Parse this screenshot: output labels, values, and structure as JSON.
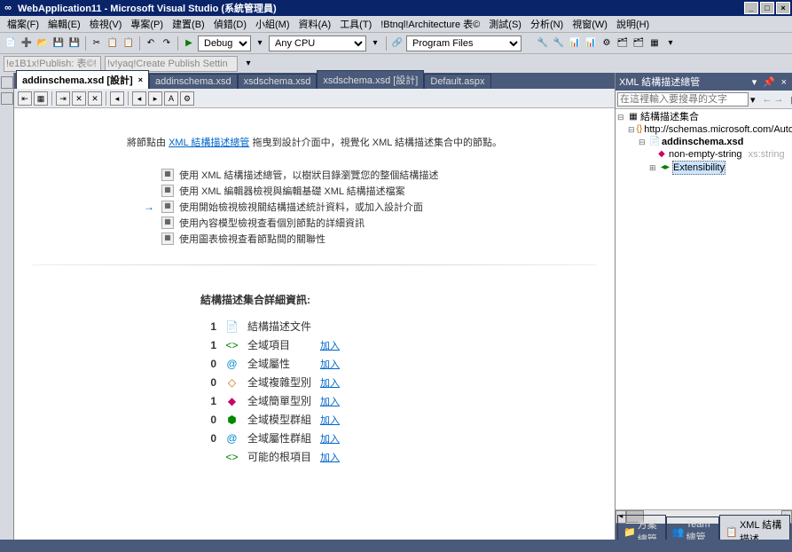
{
  "title": "WebApplication11 - Microsoft Visual Studio (系統管理員)",
  "menu": [
    "檔案(F)",
    "編輯(E)",
    "檢視(V)",
    "專案(P)",
    "建置(B)",
    "偵錯(D)",
    "小組(M)",
    "資料(A)",
    "工具(T)",
    "!Btnql!Architecture 表©",
    "測試(S)",
    "分析(N)",
    "視窗(W)",
    "說明(H)"
  ],
  "toolbar_combo_config": "Debug",
  "toolbar_combo_platform": "Any CPU",
  "toolbar_combo_find": "Program Files",
  "publish_text1": "!e1B1x!Publish: 表©!",
  "publish_text2": "!v!yaq!Create Publish Settin",
  "tabs": [
    {
      "label": "addinschema.xsd [設計]",
      "active": true,
      "close": true
    },
    {
      "label": "addinschema.xsd",
      "active": false,
      "close": false
    },
    {
      "label": "xsdschema.xsd",
      "active": false,
      "close": false
    },
    {
      "label": "xsdschema.xsd [設計]",
      "active": false,
      "close": false
    },
    {
      "label": "Default.aspx",
      "active": false,
      "close": false
    }
  ],
  "help_prefix": "將節點由 ",
  "help_link": "XML 結構描述總管",
  "help_suffix": " 拖曳到設計介面中，視覺化 XML 結構描述集合中的節點。",
  "options": [
    {
      "text": "使用 XML 結構描述總管，以樹狀目錄瀏覽您的整個結構描述",
      "arrow": false
    },
    {
      "text": "使用 XML 編輯器檢視與編輯基礎 XML 結構描述檔案",
      "arrow": false
    },
    {
      "text": "使用開始檢視檢視關結構描述統計資料，或加入設計介面",
      "arrow": true
    },
    {
      "text": "使用內容模型檢視查看個別節點的詳細資訊",
      "arrow": false
    },
    {
      "text": "使用圖表檢視查看節點間的關聯性",
      "arrow": false
    }
  ],
  "details_title": "結構描述集合詳細資訊:",
  "details": [
    {
      "count": "1",
      "icon": "📄",
      "label": "結構描述文件",
      "link": ""
    },
    {
      "count": "1",
      "icon": "<>",
      "label": "全域項目",
      "link": "加入"
    },
    {
      "count": "0",
      "icon": "@",
      "label": "全域屬性",
      "link": "加入"
    },
    {
      "count": "0",
      "icon": "◇",
      "label": "全域複雜型別",
      "link": "加入"
    },
    {
      "count": "1",
      "icon": "◆",
      "label": "全域簡單型別",
      "link": "加入"
    },
    {
      "count": "0",
      "icon": "⬢",
      "label": "全域模型群組",
      "link": "加入"
    },
    {
      "count": "0",
      "icon": "@",
      "label": "全域屬性群組",
      "link": "加入"
    },
    {
      "count": "",
      "icon": "<>",
      "label": "可能的根項目",
      "link": "加入"
    }
  ],
  "right_panel": {
    "title": "XML 結構描述總管",
    "search_placeholder": "在這裡輸入要搜尋的文字",
    "tree": {
      "root": "結構描述集合",
      "ns": "http://schemas.microsoft.com/AutomationExten",
      "file": "addinschema.xsd",
      "item1": "non-empty-string",
      "item1_type": "xs:string",
      "item2": "Extensibility"
    }
  },
  "footer_tabs": [
    {
      "label": "方案總管",
      "icon": "📁"
    },
    {
      "label": "Team 總管",
      "icon": "👥"
    },
    {
      "label": "XML 結構描述…",
      "icon": "📋",
      "active": true
    }
  ]
}
